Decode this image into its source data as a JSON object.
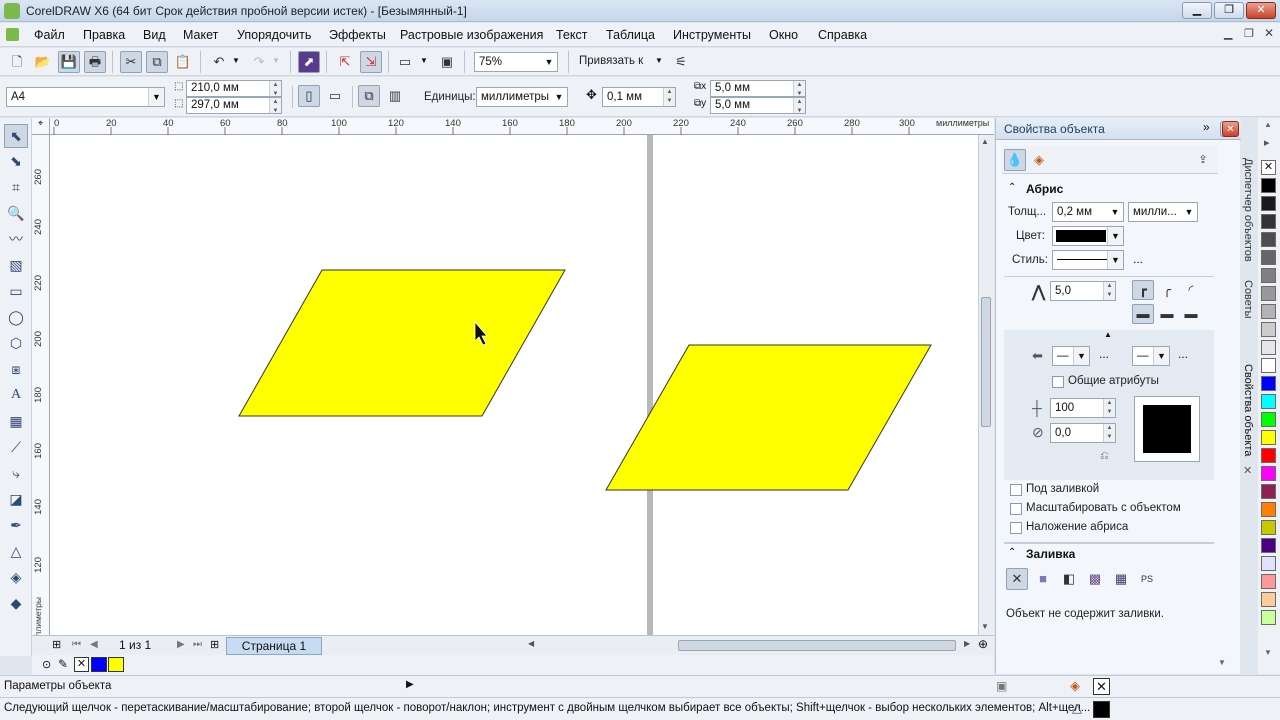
{
  "window": {
    "title": "CorelDRAW X6 (64 бит Срок действия пробной версии истек) - [Безымянный-1]"
  },
  "menu": [
    "Файл",
    "Правка",
    "Вид",
    "Макет",
    "Упорядочить",
    "Эффекты",
    "Растровые изображения",
    "Текст",
    "Таблица",
    "Инструменты",
    "Окно",
    "Справка"
  ],
  "toolbar": {
    "zoom": "75%",
    "snap_label": "Привязать к"
  },
  "propbar": {
    "page_size": "A4",
    "width": "210,0 мм",
    "height": "297,0 мм",
    "units_label": "Единицы:",
    "units_value": "миллиметры",
    "nudge": "0,1 мм",
    "dup_x": "5,0 мм",
    "dup_y": "5,0 мм"
  },
  "rulers": {
    "h_ticks": [
      "0",
      "20",
      "40",
      "60",
      "80",
      "100",
      "120",
      "140",
      "160",
      "180",
      "200",
      "220",
      "240",
      "260",
      "280",
      "300"
    ],
    "h_unit": "миллиметры",
    "v_ticks": [
      "260",
      "240",
      "220",
      "200",
      "180",
      "160",
      "140",
      "120"
    ],
    "v_unit": "миллиметры"
  },
  "pagebar": {
    "page_count": "1 из 1",
    "page_tab": "Страница 1"
  },
  "docker": {
    "title": "Свойства объекта",
    "outline_header": "Абрис",
    "width_label": "Толщ...",
    "width_value": "0,2 мм",
    "width_units": "милли...",
    "color_label": "Цвет:",
    "style_label": "Стиль:",
    "miter_value": "5,0",
    "common_attrs": "Общие атрибуты",
    "stretch_value": "100",
    "angle_value": "0,0",
    "behind_fill": "Под заливкой",
    "scale_with_object": "Масштабировать с объектом",
    "overprint": "Наложение абриса",
    "fill_header": "Заливка",
    "fill_message": "Объект не содержит заливки.",
    "more": "..."
  },
  "vertical_tabs": [
    "Диспетчер объектов",
    "Советы",
    "Свойства объекта"
  ],
  "status": {
    "object_params": "Параметры объекта",
    "hint": "Следующий щелчок - перетаскивание/масштабирование; второй щелчок - поворот/наклон; инструмент с двойным щелчком выбирает все объекты; Shift+щелчок - выбор нескольких элементов; Alt+щел..."
  },
  "colors": {
    "shape_fill": "#ffff00",
    "palette": [
      "#000000",
      "#1a1a1a",
      "#333333",
      "#4d4d4d",
      "#666666",
      "#808080",
      "#999999",
      "#b3b3b3",
      "#cccccc",
      "#e6e6e6",
      "#ffffff",
      "#0000ff",
      "#00ffff",
      "#00ff00",
      "#ffff00",
      "#ff0000",
      "#ff00ff",
      "#8b2252",
      "#ff7f00",
      "#c8c800",
      "#4b0082",
      "#e0e0ff",
      "#ff9999",
      "#ffcc99",
      "#ccff99"
    ],
    "doc_palette": [
      "#0000ff",
      "#ffff00"
    ]
  }
}
